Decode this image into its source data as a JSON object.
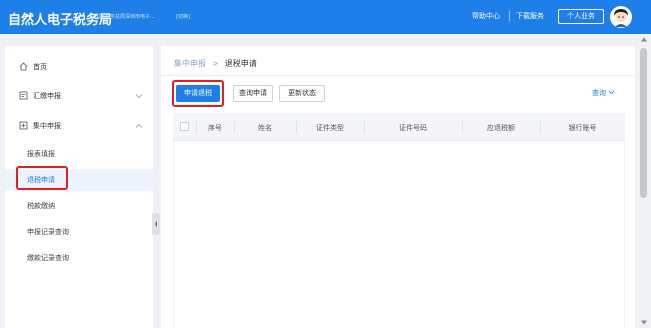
{
  "header": {
    "title": "自然人电子税务局",
    "org": "国家税务总局深圳市电子...",
    "switch": "[切换]",
    "help": "帮助中心",
    "download": "下载服务",
    "personal": "个人业务",
    "avatar_icon": "user-avatar-icon"
  },
  "sidebar": {
    "home": "首页",
    "summary": "汇缴申报",
    "centralized": "集中申报",
    "sub": [
      "报表填报",
      "退税申请",
      "税款缴纳",
      "申报记录查询",
      "缴款记录查询"
    ]
  },
  "breadcrumb": {
    "parent": "集中申报",
    "current": "退税申请"
  },
  "toolbar": {
    "apply": "申请退税",
    "status": "查询申请",
    "update": "更新状态",
    "query": "查询"
  },
  "table": {
    "columns": [
      "序号",
      "姓名",
      "证件类型",
      "证件号码",
      "应退税额",
      "银行账号"
    ]
  },
  "colors": {
    "primary": "#1f7fe8",
    "highlight": "#e02020"
  }
}
